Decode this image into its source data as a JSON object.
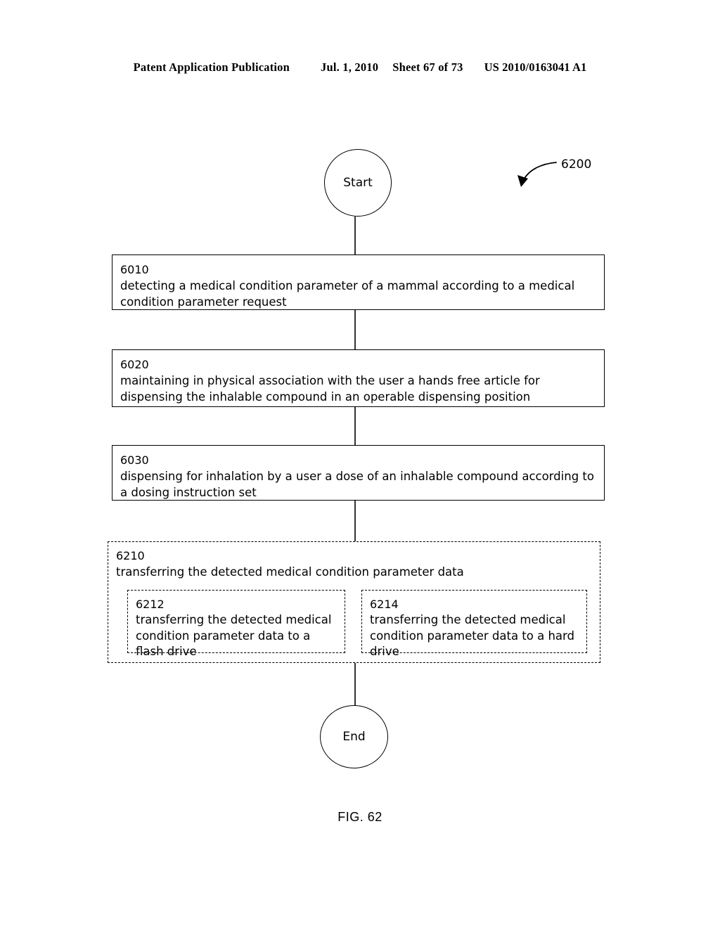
{
  "header": {
    "publication": "Patent Application Publication",
    "date": "Jul. 1, 2010",
    "sheet": "Sheet 67 of 73",
    "patent_number": "US 2010/0163041 A1"
  },
  "diagram": {
    "reference_numeral": "6200",
    "start_label": "Start",
    "end_label": "End",
    "steps": [
      {
        "ref": "6010",
        "text": "detecting a medical condition parameter of a mammal according to a medical condition parameter request"
      },
      {
        "ref": "6020",
        "text": "maintaining in physical association with the user a hands free article for dispensing the inhalable compound in an operable dispensing position"
      },
      {
        "ref": "6030",
        "text": "dispensing for inhalation by a user a dose of an inhalable compound according to a dosing instruction set"
      }
    ],
    "optional_step": {
      "ref": "6210",
      "text": "transferring the detected medical condition parameter data",
      "sub_steps": [
        {
          "ref": "6212",
          "text": "transferring the detected medical condition parameter data to a flash drive"
        },
        {
          "ref": "6214",
          "text": "transferring the detected medical condition parameter data to a hard drive"
        }
      ]
    }
  },
  "caption": "FIG. 62"
}
